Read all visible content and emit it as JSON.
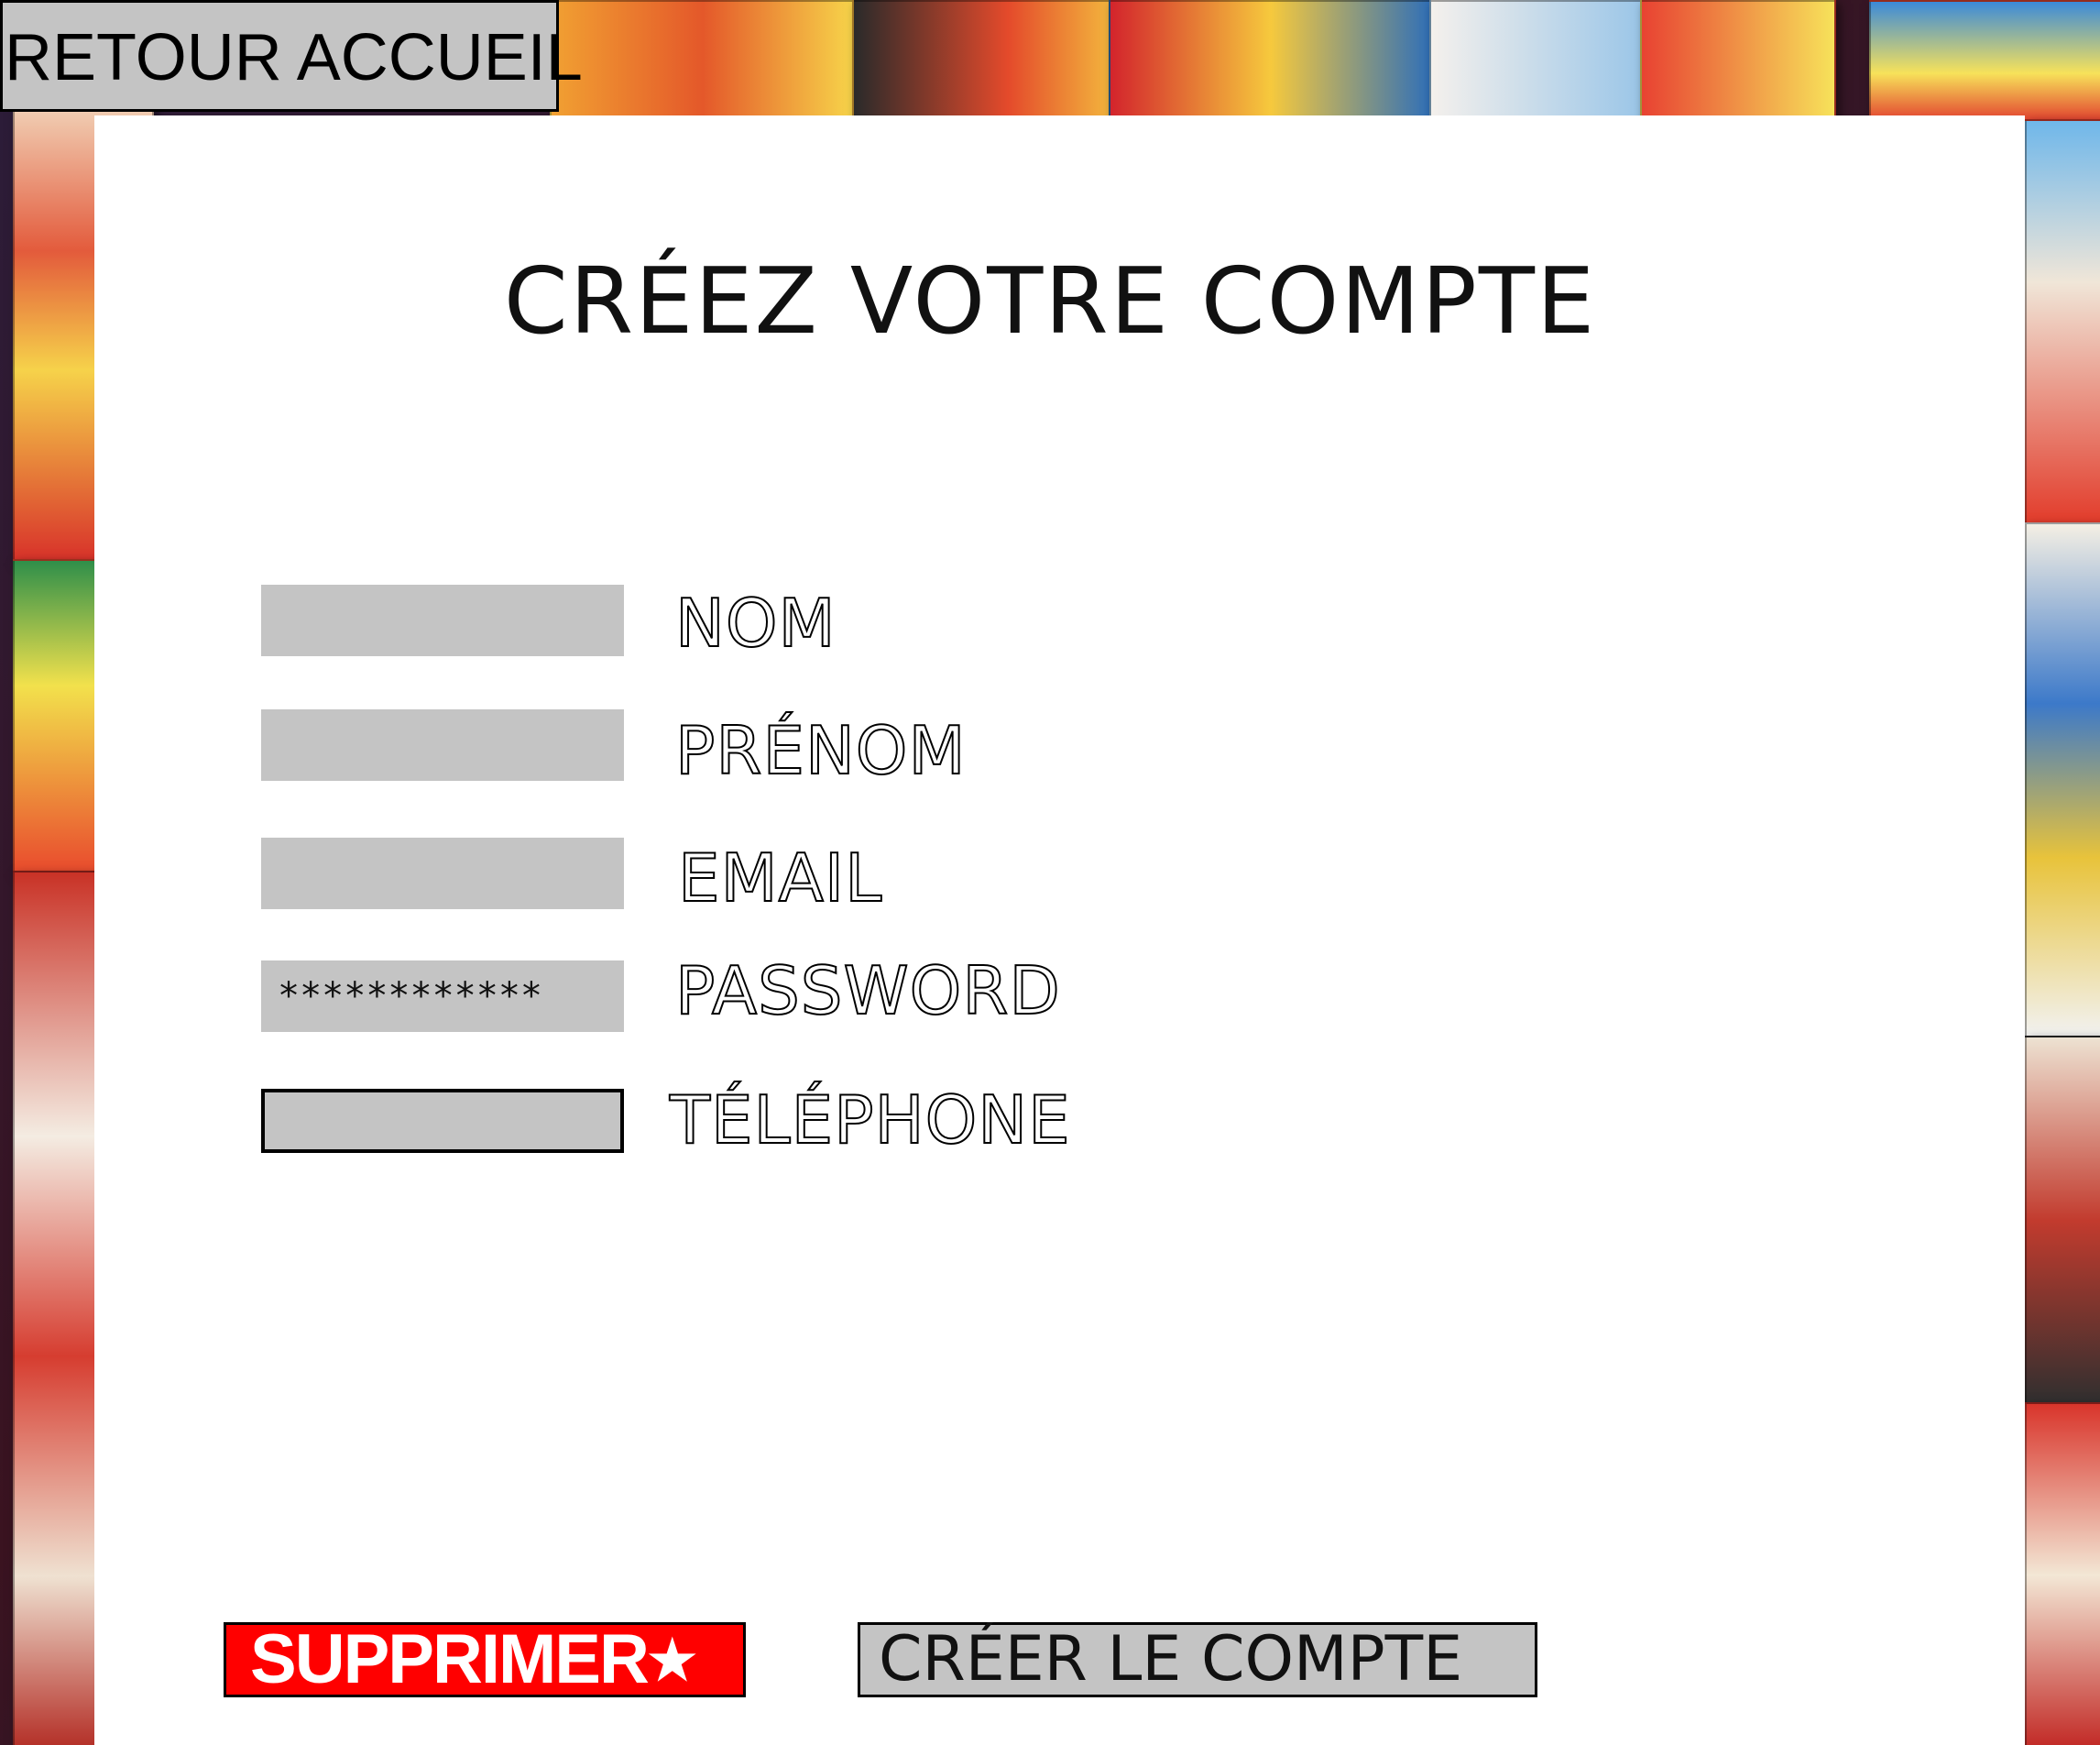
{
  "nav": {
    "back_label": "RETOUR ACCUEIL"
  },
  "form": {
    "title": "CRÉEZ VOTRE COMPTE",
    "fields": [
      {
        "label": "NOM",
        "value": "",
        "type": "text"
      },
      {
        "label": "PRÉNOM",
        "value": "",
        "type": "text"
      },
      {
        "label": "EMAIL",
        "value": "",
        "type": "text"
      },
      {
        "label": "PASSWORD",
        "value": "************",
        "type": "password"
      },
      {
        "label": "TÉLÉPHONE",
        "value": "",
        "type": "text",
        "focused": true
      }
    ]
  },
  "actions": {
    "delete_label": "SUPPRIMER",
    "delete_icon": "star-icon",
    "create_label": "CRÉER LE COMPTE"
  },
  "colors": {
    "field_bg": "#c4c4c4",
    "delete_bg": "#ff0000",
    "panel_bg": "#ffffff"
  }
}
